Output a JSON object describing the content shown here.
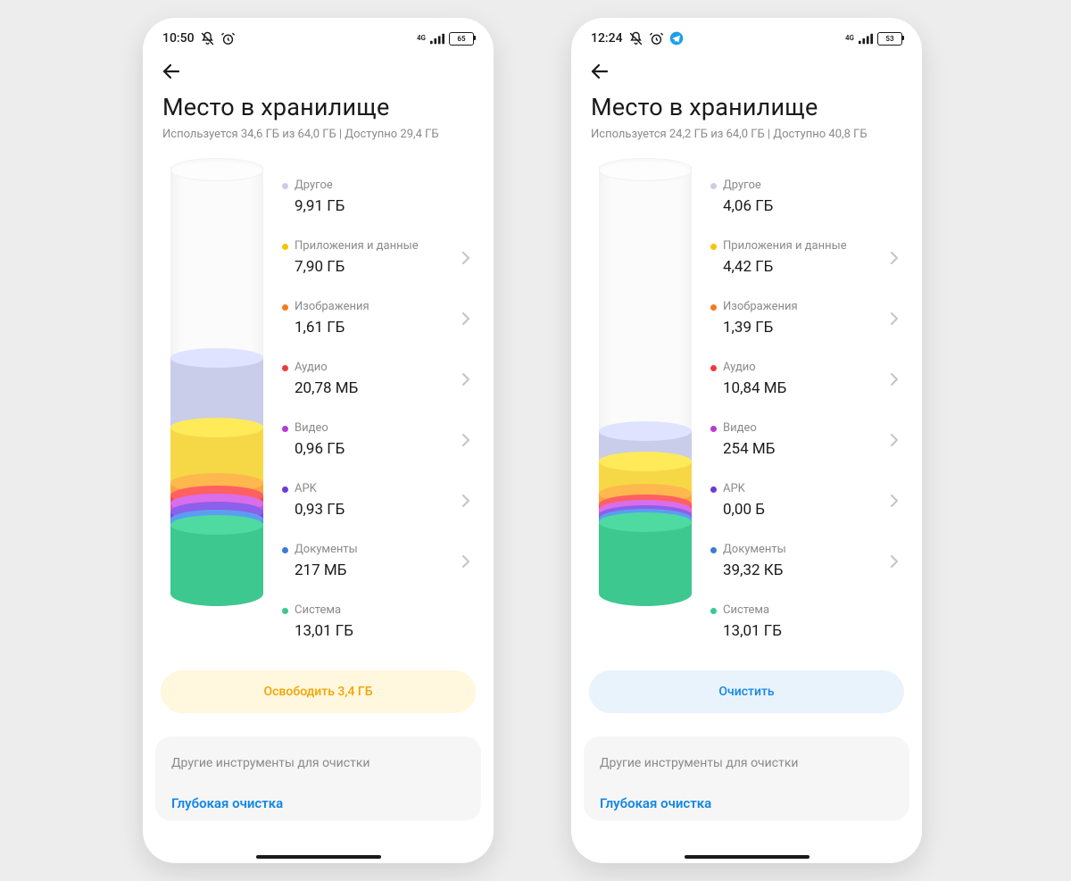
{
  "screens": [
    {
      "status": {
        "time": "10:50",
        "battery": "65",
        "tgIcon": false
      },
      "title": "Место в хранилище",
      "subtitle": "Используется 34,6 ГБ из 64,0 ГБ | Доступно 29,4 ГБ",
      "fillTop": 214,
      "categories": [
        {
          "label": "Другое",
          "value": "9,91 ГБ",
          "color": "#c9cde9",
          "chevron": false
        },
        {
          "label": "Приложения и данные",
          "value": "7,90 ГБ",
          "color": "#f6c500",
          "chevron": true
        },
        {
          "label": "Изображения",
          "value": "1,61 ГБ",
          "color": "#f77b1b",
          "chevron": true
        },
        {
          "label": "Аудио",
          "value": "20,78 МБ",
          "color": "#ef3b3b",
          "chevron": true
        },
        {
          "label": "Видео",
          "value": "0,96 ГБ",
          "color": "#b63bd6",
          "chevron": true
        },
        {
          "label": "APK",
          "value": "0,93 ГБ",
          "color": "#6a3bd6",
          "chevron": true
        },
        {
          "label": "Документы",
          "value": "217 МБ",
          "color": "#3b7bd6",
          "chevron": true
        },
        {
          "label": "Система",
          "value": "13,01 ГБ",
          "color": "#3cc88f",
          "chevron": false
        }
      ],
      "segments": [
        {
          "color": "#c9cde9",
          "height": 78
        },
        {
          "color": "#f6d847",
          "height": 62
        },
        {
          "color": "#f6a63c",
          "height": 14
        },
        {
          "color": "#ef4e4e",
          "height": 9
        },
        {
          "color": "#c85bd8",
          "height": 9
        },
        {
          "color": "#7a4ed8",
          "height": 9
        },
        {
          "color": "#4a8be0",
          "height": 6
        },
        {
          "color": "#3cc88f",
          "height": 92
        }
      ],
      "button": {
        "label": "Освободить 3,4 ГБ",
        "style": "btn-yellow"
      },
      "card": {
        "title": "Другие инструменты для очистки",
        "deep": "Глубокая очистка"
      }
    },
    {
      "status": {
        "time": "12:24",
        "battery": "53",
        "tgIcon": true
      },
      "title": "Место в хранилище",
      "subtitle": "Используется 24,2 ГБ из 64,0 ГБ | Доступно 40,8 ГБ",
      "fillTop": 296,
      "categories": [
        {
          "label": "Другое",
          "value": "4,06 ГБ",
          "color": "#c9cde9",
          "chevron": false
        },
        {
          "label": "Приложения и данные",
          "value": "4,42 ГБ",
          "color": "#f6c500",
          "chevron": true
        },
        {
          "label": "Изображения",
          "value": "1,39 ГБ",
          "color": "#f77b1b",
          "chevron": true
        },
        {
          "label": "Аудио",
          "value": "10,84 МБ",
          "color": "#ef3b3b",
          "chevron": true
        },
        {
          "label": "Видео",
          "value": "254 МБ",
          "color": "#b63bd6",
          "chevron": true
        },
        {
          "label": "APK",
          "value": "0,00 Б",
          "color": "#6a3bd6",
          "chevron": true
        },
        {
          "label": "Документы",
          "value": "39,32 КБ",
          "color": "#3b7bd6",
          "chevron": true
        },
        {
          "label": "Система",
          "value": "13,01 ГБ",
          "color": "#3cc88f",
          "chevron": false
        }
      ],
      "segments": [
        {
          "color": "#c9cde9",
          "height": 34
        },
        {
          "color": "#f6d847",
          "height": 36
        },
        {
          "color": "#f6a63c",
          "height": 12
        },
        {
          "color": "#ef4e4e",
          "height": 6
        },
        {
          "color": "#c85bd8",
          "height": 6
        },
        {
          "color": "#7a4ed8",
          "height": 4
        },
        {
          "color": "#4a8be0",
          "height": 4
        },
        {
          "color": "#3cc88f",
          "height": 94
        }
      ],
      "button": {
        "label": "Очистить",
        "style": "btn-blue"
      },
      "card": {
        "title": "Другие инструменты для очистки",
        "deep": "Глубокая очистка"
      }
    }
  ]
}
